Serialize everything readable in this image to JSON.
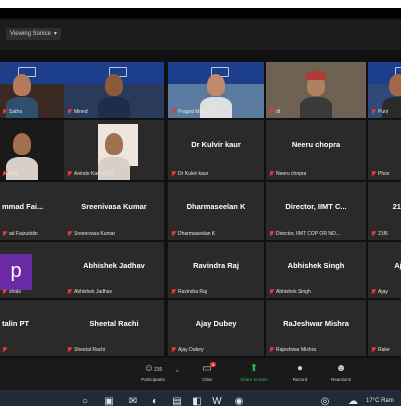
{
  "header": {
    "view_mode": "Viewing Sonice",
    "caret": "▾"
  },
  "tiles": [
    {
      "row": 0,
      "col": 0,
      "name": "",
      "label": "Satha",
      "video": true
    },
    {
      "row": 0,
      "col": 1,
      "name": "",
      "label": "Mined",
      "video": true
    },
    {
      "row": 0,
      "col": 2,
      "name": "",
      "label": "Prageti Mahan",
      "video": true,
      "active": true
    },
    {
      "row": 0,
      "col": 3,
      "name": "",
      "label": "dt",
      "video": true
    },
    {
      "row": 0,
      "col": 4,
      "name": "",
      "label": "Puni",
      "video": true
    },
    {
      "row": 1,
      "col": 0,
      "name": "",
      "label": "kaur",
      "video": true
    },
    {
      "row": 1,
      "col": 1,
      "name": "",
      "label": "Anindo Kaur DCR",
      "video": true
    },
    {
      "row": 1,
      "col": 2,
      "name": "Dr Kulvir kaur",
      "label": "Dr Kulvir kaur"
    },
    {
      "row": 1,
      "col": 3,
      "name": "Neeru chopra",
      "label": "Neeru chopra"
    },
    {
      "row": 1,
      "col": 4,
      "name": "",
      "label": "Phos"
    },
    {
      "row": 2,
      "col": 0,
      "name": "mmad Fai...",
      "label": "ad Faizuddin"
    },
    {
      "row": 2,
      "col": 1,
      "name": "Sreenivasa Kumar",
      "label": "Sreenivasa Kumar"
    },
    {
      "row": 2,
      "col": 2,
      "name": "Dharmaseelan K",
      "label": "Dharmaseelan K"
    },
    {
      "row": 2,
      "col": 3,
      "name": "Director,  IIMT C...",
      "label": "Director,  IIMT COP OR NO..."
    },
    {
      "row": 2,
      "col": 4,
      "name": "21f",
      "label": "21f6"
    },
    {
      "row": 3,
      "col": 0,
      "name": "",
      "label": "shala",
      "avatar": "p"
    },
    {
      "row": 3,
      "col": 1,
      "name": "Abhishek Jadhav",
      "label": "Abhishek Jadhav"
    },
    {
      "row": 3,
      "col": 2,
      "name": "Ravindra Raj",
      "label": "Ravindra Raj"
    },
    {
      "row": 3,
      "col": 3,
      "name": "Abhishek Singh",
      "label": "Abhishek Singh"
    },
    {
      "row": 3,
      "col": 4,
      "name": "Aj",
      "label": "Ajay"
    },
    {
      "row": 4,
      "col": 0,
      "name": "talin PT",
      "label": ""
    },
    {
      "row": 4,
      "col": 1,
      "name": "Sheetal Rachi",
      "label": "Sheetal Rachi"
    },
    {
      "row": 4,
      "col": 2,
      "name": "Ajay Dubey",
      "label": "Ajay Dubey"
    },
    {
      "row": 4,
      "col": 3,
      "name": "RaJeshwar Mishra",
      "label": "Rajeshwar Mishra"
    },
    {
      "row": 4,
      "col": 4,
      "name": "",
      "label": "Rake"
    }
  ],
  "toolbar": {
    "participants_count": "235",
    "participants_label": "Participants",
    "chat_label": "Chat",
    "chat_badge": "6",
    "share_label": "Share Screen",
    "record_label": "Record",
    "reactions_label": "Reactions"
  },
  "taskbar": {
    "weather": "17°C Ram"
  },
  "colors": {
    "tile_bg": "#2a2a2a",
    "active_border": "#c7e23c",
    "share_green": "#2dbb52",
    "mute_red": "#e03b3b"
  }
}
